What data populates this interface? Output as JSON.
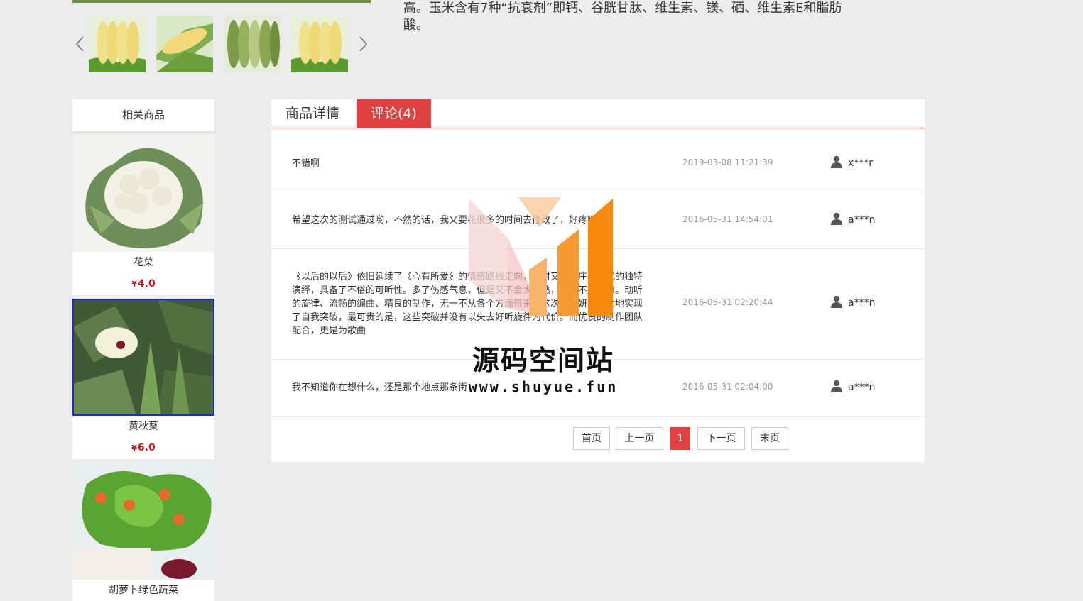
{
  "product": {
    "description_lines": [
      "高。玉米含有7种“抗衰剂”即钙、谷胱甘肽、维生素、镁、硒、维生素E和脂肪",
      "酸。"
    ]
  },
  "gallery": {
    "thumbnails": [
      {
        "icon": "yellow-corn-image"
      },
      {
        "icon": "sweet-corn-image"
      },
      {
        "icon": "green-corn-image"
      },
      {
        "icon": "yellow-corn-image"
      }
    ]
  },
  "related": {
    "title": "相关商品",
    "items": [
      {
        "name": "花菜",
        "currency": "¥",
        "price": "4.0",
        "icon": "cauliflower-image"
      },
      {
        "name": "黄秋葵",
        "currency": "¥",
        "price": "6.0",
        "icon": "okra-image"
      },
      {
        "name": "胡萝卜绿色蔬菜",
        "icon": "carrot-image"
      }
    ]
  },
  "tabs": [
    {
      "label": "商品详情"
    },
    {
      "label": "评论(4)"
    }
  ],
  "comments": [
    {
      "text": "不错啊",
      "date": "2019-03-08 11:21:39",
      "user": "x***r"
    },
    {
      "text": "希望这次的测试通过哟，不然的话，我又要花很多的时间去修改了，好疼哟!",
      "date": "2016-05-31 14:54:01",
      "user": "a***n"
    },
    {
      "text": "《以后的以后》依旧延续了《心有所爱》的情感路线走向，同时又不失庄心妍式的独特演绎，具备了不俗的可听性。多了伤感气息，但是又不会太成熟，又有不少新意。动听的旋律、流畅的编曲、精良的制作，无一不从各个方面带来了这次庄心妍都成功地实现了自我突破，最可贵的是，这些突破并没有以失去好听旋律为代价。而优良的制作团队配合，更是为歌曲",
      "date": "2016-05-31 02:20:44",
      "user": "a***n"
    },
    {
      "text": "我不知道你在想什么，还是那个地点那条街",
      "date": "2016-05-31 02:04:00",
      "user": "a***n"
    }
  ],
  "pager": {
    "first": "首页",
    "prev": "上一页",
    "current": "1",
    "next": "下一页",
    "last": "末页"
  },
  "watermark": {
    "title": "源码空间站",
    "url": "www.shuyue.fun"
  },
  "colors": {
    "accent_red": "#e04141",
    "price_red": "#c8161d",
    "background": "#ececec",
    "watermark_orange": "#f7890f"
  }
}
